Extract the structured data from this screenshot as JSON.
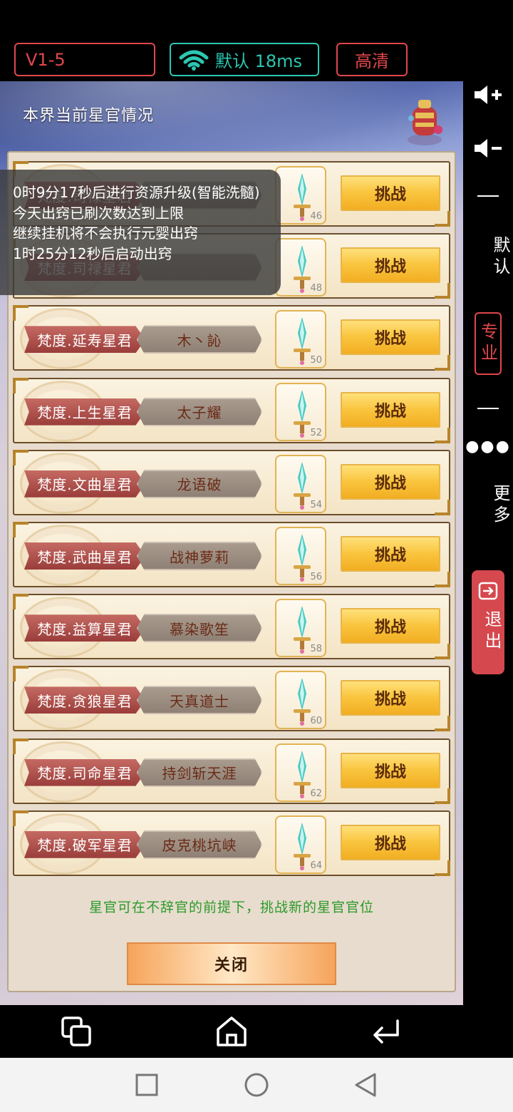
{
  "topbar": {
    "version": "V1-5",
    "network_label": "默认 18ms",
    "quality": "高清"
  },
  "panel": {
    "title": "本界当前星官情况",
    "rows": [
      {
        "rank": "梵度.司禄星君",
        "name": "",
        "level": "46",
        "button": "挑战"
      },
      {
        "rank": "梵度.司禄星君",
        "name": "",
        "level": "48",
        "button": "挑战"
      },
      {
        "rank": "梵度.延寿星君",
        "name": "木丶訫",
        "level": "50",
        "button": "挑战"
      },
      {
        "rank": "梵度.上生星君",
        "name": "太子耀",
        "level": "52",
        "button": "挑战"
      },
      {
        "rank": "梵度.文曲星君",
        "name": "龙语破",
        "level": "54",
        "button": "挑战"
      },
      {
        "rank": "梵度.武曲星君",
        "name": "战神萝莉",
        "level": "56",
        "button": "挑战"
      },
      {
        "rank": "梵度.益算星君",
        "name": "慕染歌笙",
        "level": "58",
        "button": "挑战"
      },
      {
        "rank": "梵度.贪狼星君",
        "name": "天真道士",
        "level": "60",
        "button": "挑战"
      },
      {
        "rank": "梵度.司命星君",
        "name": "持剑斩天涯",
        "level": "62",
        "button": "挑战"
      },
      {
        "rank": "梵度.破军星君",
        "name": "皮克桃坑峡",
        "level": "64",
        "button": "挑战"
      }
    ],
    "tip": "星官可在不辞官的前提下，挑战新的星官官位",
    "close_label": "关闭"
  },
  "toast": {
    "lines": [
      "0时9分17秒后进行资源升级(智能洗髓)",
      "今天出窍已刷次数达到上限",
      "继续挂机将不会执行元婴出窍",
      "1时25分12秒后启动出窍"
    ]
  },
  "sidebar": {
    "default_label": "默认",
    "pro_label": "专业",
    "more_label": "更多",
    "exit_label": "退出"
  },
  "colors": {
    "accent_red": "#e0474c",
    "accent_teal": "#2bc7b1",
    "tip_green": "#2c9a2b",
    "button_gold": "#f9c43d"
  }
}
